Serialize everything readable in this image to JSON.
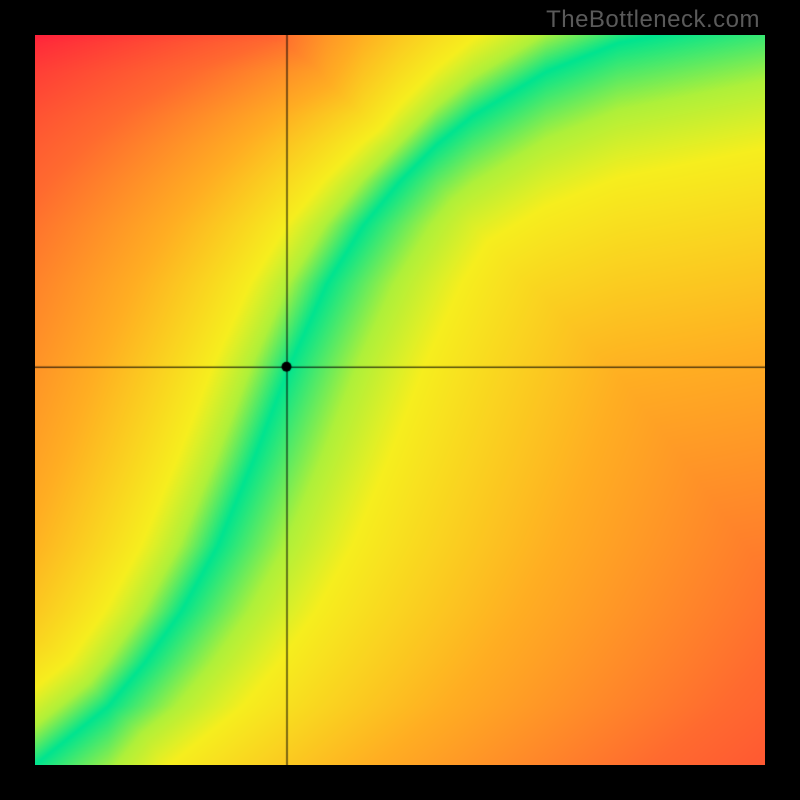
{
  "watermark": "TheBottleneck.com",
  "chart_data": {
    "type": "heatmap",
    "title": "",
    "xlabel": "",
    "ylabel": "",
    "xlim": [
      0,
      1
    ],
    "ylim": [
      0,
      1
    ],
    "marker": {
      "x": 0.345,
      "y": 0.545
    },
    "optimal_curve_xy": [
      [
        0.0,
        0.0
      ],
      [
        0.05,
        0.04
      ],
      [
        0.1,
        0.08
      ],
      [
        0.15,
        0.14
      ],
      [
        0.2,
        0.21
      ],
      [
        0.25,
        0.3
      ],
      [
        0.3,
        0.42
      ],
      [
        0.35,
        0.55
      ],
      [
        0.4,
        0.66
      ],
      [
        0.45,
        0.74
      ],
      [
        0.5,
        0.8
      ],
      [
        0.55,
        0.85
      ],
      [
        0.6,
        0.89
      ],
      [
        0.65,
        0.92
      ],
      [
        0.7,
        0.95
      ],
      [
        0.75,
        0.97
      ],
      [
        0.8,
        0.99
      ],
      [
        0.85,
        1.0
      ]
    ],
    "color_stops": [
      {
        "dist": 0.0,
        "color": "#00e48f"
      },
      {
        "dist": 0.06,
        "color": "#aef03a"
      },
      {
        "dist": 0.12,
        "color": "#f6ee1e"
      },
      {
        "dist": 0.3,
        "color": "#ffae22"
      },
      {
        "dist": 0.55,
        "color": "#ff6a2f"
      },
      {
        "dist": 1.0,
        "color": "#ff1c3c"
      }
    ],
    "distance_bonus_upper_right": 0.35
  }
}
